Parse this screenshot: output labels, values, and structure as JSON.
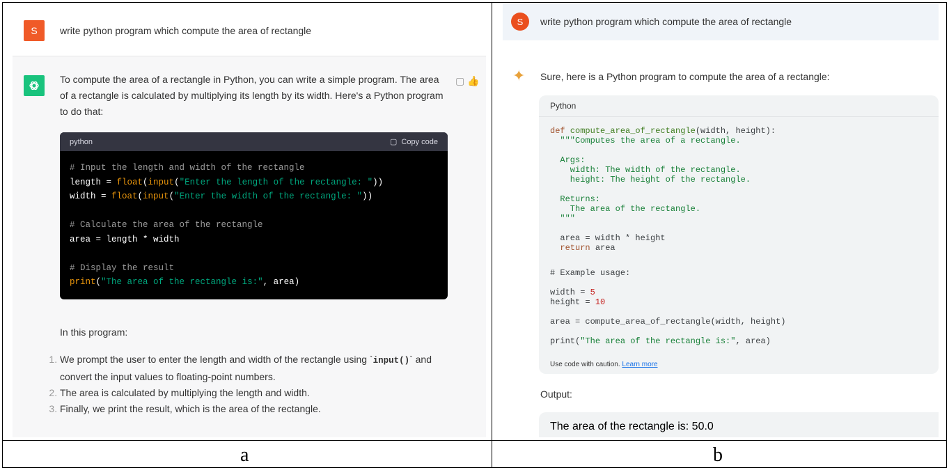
{
  "panel_a": {
    "user_avatar_letter": "S",
    "user_prompt": "write python program which compute the area of rectangle",
    "response_intro": "To compute the area of a rectangle in Python, you can write a simple program. The area of a rectangle is calculated by multiplying its length by its width. Here's a Python program to do that:",
    "code_language": "python",
    "copy_label": "Copy code",
    "code_lines": {
      "l1": "# Input the length and width of the rectangle",
      "l2_a": "length = ",
      "l2_b": "float",
      "l2_c": "(",
      "l2_d": "input",
      "l2_e": "(",
      "l2_f": "\"Enter the length of the rectangle: \"",
      "l2_g": "))",
      "l3_a": "width = ",
      "l3_b": "float",
      "l3_c": "(",
      "l3_d": "input",
      "l3_e": "(",
      "l3_f": "\"Enter the width of the rectangle: \"",
      "l3_g": "))",
      "l4": "# Calculate the area of the rectangle",
      "l5": "area = length * width",
      "l6": "# Display the result",
      "l7_a": "print",
      "l7_b": "(",
      "l7_c": "\"The area of the rectangle is:\"",
      "l7_d": ", area)"
    },
    "in_this_program": "In this program:",
    "steps": {
      "s1_a": "We prompt the user to enter the length and width of the rectangle using `",
      "s1_code": "input()",
      "s1_b": "` and convert the input values to floating-point numbers.",
      "s2": "The area is calculated by multiplying the length and width.",
      "s3": "Finally, we print the result, which is the area of the rectangle."
    },
    "caption": "a"
  },
  "panel_b": {
    "user_avatar_letter": "S",
    "user_prompt": "write python program which compute the area of rectangle",
    "response_intro": "Sure, here is a Python program to compute the area of a rectangle:",
    "code_language": "Python",
    "code": {
      "l1_a": "def ",
      "l1_b": "compute_area_of_rectangle",
      "l1_c": "(width, height):",
      "l2": "  \"\"\"Computes the area of a rectangle.",
      "l3": "  Args:",
      "l4": "    width: The width of the rectangle.",
      "l5": "    height: The height of the rectangle.",
      "l6": "  Returns:",
      "l7": "    The area of the rectangle.",
      "l8": "  \"\"\"",
      "l9": "  area = width * height",
      "l10_a": "  ",
      "l10_b": "return",
      "l10_c": " area",
      "l11": "# Example usage:",
      "l12_a": "width = ",
      "l12_b": "5",
      "l13_a": "height = ",
      "l13_b": "10",
      "l14": "area = compute_area_of_rectangle(width, height)",
      "l15_a": "print(",
      "l15_b": "\"The area of the rectangle is:\"",
      "l15_c": ", area)"
    },
    "caution_text": "Use code with caution. ",
    "learn_more": "Learn more",
    "output_label": "Output:",
    "output_text": "The area of the rectangle is: 50.0",
    "caption": "b"
  },
  "colors": {
    "chatgpt_green": "#19c37d",
    "avatar_orange": "#f05a28",
    "code_bg": "#000000",
    "bard_spark": "#e8a13a"
  }
}
